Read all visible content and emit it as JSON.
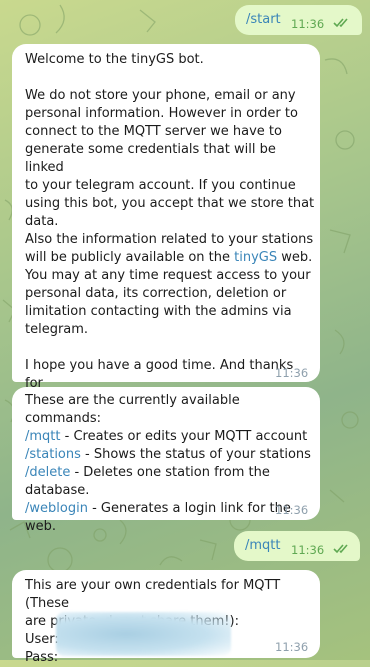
{
  "colors": {
    "link": "#3a85b8",
    "outgoing_bubble": "#e4f8c9",
    "incoming_bubble": "#ffffff",
    "outgoing_time": "#5fa852"
  },
  "messages": {
    "m1": {
      "text": "/start",
      "time": "11:36",
      "status_icon": "double-check-icon"
    },
    "m2": {
      "p1": "Welcome to the tinyGS bot.",
      "p2": "We do not store your phone, email or any\npersonal information. However in order to\nconnect to the MQTT server we have to\ngenerate some credentials that will be linked\nto your telegram account. If you continue\nusing this bot, you accept that we store that\ndata.\nAlso the information related to your stations\nwill be publicly available on the ",
      "link": "tinyGS",
      "p3": " web.\nYou may at any time request access to your\npersonal data, its correction, deletion or\nlimitation contacting with the admins via\ntelegram.",
      "p4": "I hope you have a good time. And thanks for\njoining the TinyGS community.",
      "time": "11:36"
    },
    "m3": {
      "intro": "These are the currently available commands:",
      "commands": [
        {
          "cmd": "/mqtt",
          "desc": " - Creates or edits your MQTT account"
        },
        {
          "cmd": "/stations",
          "desc": " - Shows the status of your stations"
        },
        {
          "cmd": "/delete",
          "desc": " - Deletes one station from the\ndatabase."
        },
        {
          "cmd": "/weblogin",
          "desc": " - Generates a login link for the web."
        }
      ],
      "time": "11:36"
    },
    "m4": {
      "text": "/mqtt",
      "time": "11:36",
      "status_icon": "double-check-icon"
    },
    "m5": {
      "text": "This are your own credentials for MQTT (These\nare private, do not share them!):",
      "user_label": "User:",
      "pass_label": "Pass:",
      "time": "11:36"
    }
  }
}
